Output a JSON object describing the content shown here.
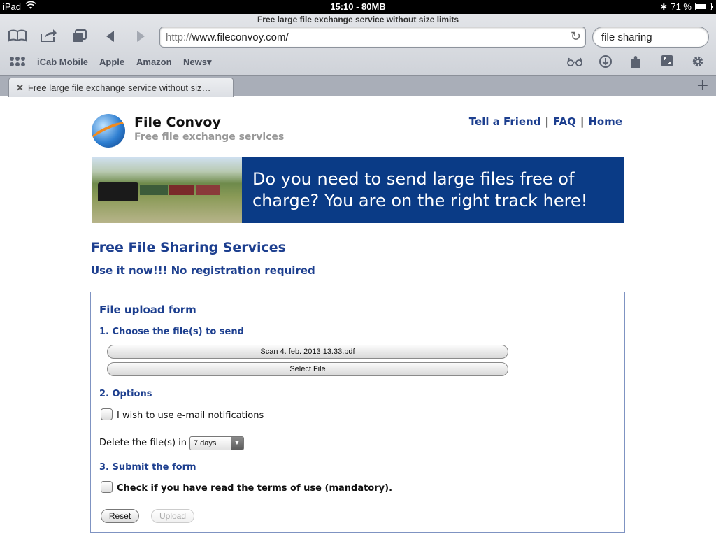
{
  "status_bar": {
    "device": "iPad",
    "center": "15:10 - 80MB",
    "battery": "71 %",
    "battery_level": 0.71
  },
  "browser": {
    "page_title": "Free large file exchange service without size limits",
    "url_prefix": "http://",
    "url_host": "www.fileconvoy.com/",
    "search_value": "file sharing",
    "bookmarks": [
      "iCab Mobile",
      "Apple",
      "Amazon",
      "News▾"
    ],
    "tab_label": "Free large file exchange service without siz…"
  },
  "site": {
    "name": "File Convoy",
    "tagline": "Free file exchange services",
    "nav": [
      "Tell a Friend",
      "FAQ",
      "Home"
    ],
    "banner_text": "Do you  need to send large files free of charge? You are on the right track here!",
    "heading": "Free File Sharing Services",
    "subheading": "Use it now!!! No registration required"
  },
  "form": {
    "title": "File upload form",
    "step1": "1. Choose the file(s) to send",
    "file_selected": "Scan 4. feb. 2013 13.33.pdf",
    "select_file_button": "Select File",
    "step2": "2. Options",
    "email_notify_label": "I wish to use e-mail notifications",
    "delete_label": "Delete the file(s) in",
    "delete_value": "7 days",
    "step3": "3. Submit the form",
    "terms_label": "Check if you have read the terms of use (mandatory).",
    "reset_button": "Reset",
    "upload_button": "Upload"
  }
}
